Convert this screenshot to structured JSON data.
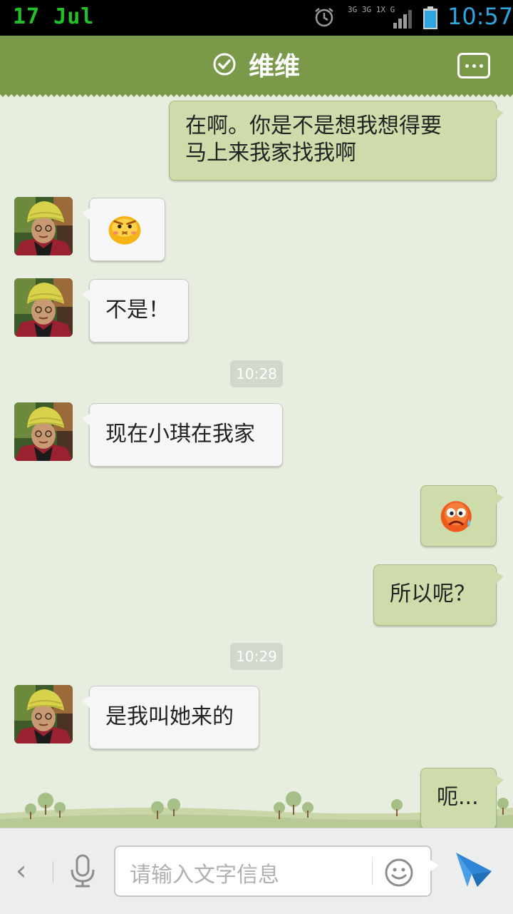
{
  "status_bar": {
    "date": "17 Jul",
    "network_top": "3G 3G 1X G",
    "time": "10:57",
    "icons": [
      "alarm-icon",
      "signal-icon",
      "battery-icon"
    ]
  },
  "header": {
    "title": "维维",
    "verified_icon": "verified-check-icon",
    "more_icon": "more-dots-icon"
  },
  "messages": [
    {
      "side": "out",
      "type": "text",
      "text_lines": [
        "在啊。你是不是想我想得要",
        "马上来我家找我啊"
      ]
    },
    {
      "side": "in",
      "type": "emoji",
      "emoji": "angry-yellow-face"
    },
    {
      "side": "in",
      "type": "text",
      "text": "不是！"
    },
    {
      "type": "timestamp",
      "text": "10:28"
    },
    {
      "side": "in",
      "type": "text",
      "text": "现在小琪在我家"
    },
    {
      "side": "out",
      "type": "emoji",
      "emoji": "sweating-orange-face"
    },
    {
      "side": "out",
      "type": "text",
      "text": "所以呢？"
    },
    {
      "type": "timestamp",
      "text": "10:29"
    },
    {
      "side": "in",
      "type": "text",
      "text": "是我叫她来的"
    },
    {
      "side": "out",
      "type": "text",
      "text": "呃..."
    }
  ],
  "input_bar": {
    "placeholder": "请输入文字信息",
    "back_icon": "chevron-left-icon",
    "mic_icon": "microphone-icon",
    "emoji_icon": "smiley-icon",
    "send_icon": "send-paper-plane-icon"
  },
  "colors": {
    "header_bg": "#7a9a4a",
    "chat_bg": "#e8eedf",
    "out_bubble": "#cddcaa",
    "in_bubble": "#f6f6f6",
    "time_accent": "#2fa5e0",
    "date_accent": "#22c02a"
  }
}
